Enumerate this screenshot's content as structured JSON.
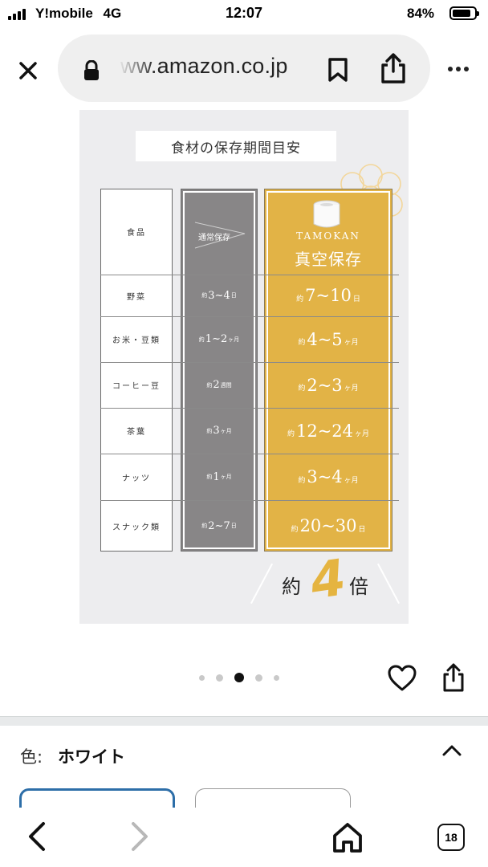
{
  "status_bar": {
    "carrier": "Y!mobile",
    "network": "4G",
    "time": "12:07",
    "battery_percent": "84%",
    "battery_level": 0.84
  },
  "browser": {
    "url": "ww.amazon.co.jp",
    "icons": [
      "close-icon",
      "lock-icon",
      "bookmark-icon",
      "share-icon",
      "more-icon"
    ]
  },
  "product_image": {
    "title": "食材の保存期間目安",
    "header_food": "食品",
    "header_normal": "通常保存",
    "brand": "TAMOKAN",
    "header_vacuum": "真空保存",
    "rows": [
      {
        "food": "野菜",
        "normal": {
          "pre": "約",
          "num": "3~4",
          "suf": "日"
        },
        "vacuum": {
          "pre": "約",
          "num": "7~10",
          "suf": "日"
        }
      },
      {
        "food": "お米・豆類",
        "normal": {
          "pre": "約",
          "num": "1~2",
          "suf": "ヶ月"
        },
        "vacuum": {
          "pre": "約",
          "num": "4~5",
          "suf": "ヶ月"
        }
      },
      {
        "food": "コーヒー豆",
        "normal": {
          "pre": "約",
          "num": "2",
          "suf": "週間"
        },
        "vacuum": {
          "pre": "約",
          "num": "2~3",
          "suf": "ヶ月"
        }
      },
      {
        "food": "茶葉",
        "normal": {
          "pre": "約",
          "num": "3",
          "suf": "ヶ月"
        },
        "vacuum": {
          "pre": "約",
          "num": "12~24",
          "suf": "ヶ月"
        }
      },
      {
        "food": "ナッツ",
        "normal": {
          "pre": "約",
          "num": "1",
          "suf": "ヶ月"
        },
        "vacuum": {
          "pre": "約",
          "num": "3~4",
          "suf": "ヶ月"
        }
      },
      {
        "food": "スナック類",
        "normal": {
          "pre": "約",
          "num": "2~7",
          "suf": "日"
        },
        "vacuum": {
          "pre": "約",
          "num": "20~30",
          "suf": "日"
        }
      }
    ],
    "badge": {
      "pre": "約",
      "num": "4",
      "suf": "倍"
    },
    "colors": {
      "normal": "#888687",
      "vacuum": "#e2b346",
      "background": "#ededef"
    }
  },
  "carousel": {
    "dot_count": 5,
    "active_index": 2
  },
  "variation": {
    "label": "色:",
    "value": "ホワイト"
  },
  "toolbar": {
    "tab_count": "18"
  }
}
